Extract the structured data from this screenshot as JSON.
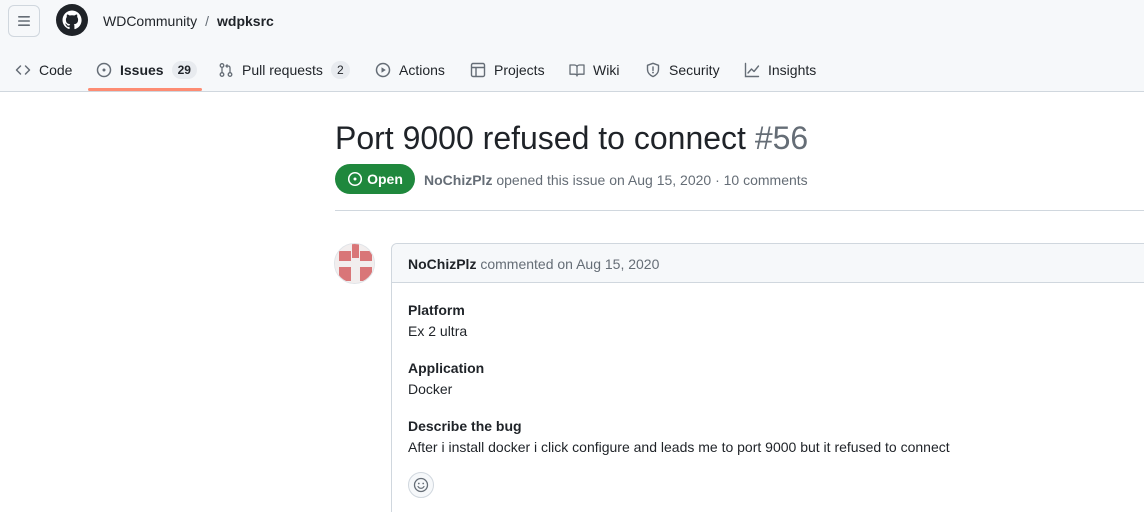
{
  "header": {
    "owner": "WDCommunity",
    "separator": "/",
    "repo": "wdpksrc"
  },
  "tabs": [
    {
      "label": "Code",
      "icon": "code-icon"
    },
    {
      "label": "Issues",
      "icon": "issue-opened-icon",
      "count": "29",
      "selected": true
    },
    {
      "label": "Pull requests",
      "icon": "git-pull-request-icon",
      "count": "2"
    },
    {
      "label": "Actions",
      "icon": "play-icon"
    },
    {
      "label": "Projects",
      "icon": "table-icon"
    },
    {
      "label": "Wiki",
      "icon": "book-icon"
    },
    {
      "label": "Security",
      "icon": "shield-icon"
    },
    {
      "label": "Insights",
      "icon": "graph-icon"
    }
  ],
  "issue": {
    "title": "Port 9000 refused to connect",
    "number": "#56",
    "state": "Open",
    "author": "NoChizPlz",
    "meta_text": "opened this issue on Aug 15, 2020 · 10 comments"
  },
  "comment": {
    "author": "NoChizPlz",
    "header_text": "commented on Aug 15, 2020",
    "fields": [
      {
        "label": "Platform",
        "value": "Ex 2 ultra"
      },
      {
        "label": "Application",
        "value": "Docker"
      },
      {
        "label": "Describe the bug",
        "value": "After i install docker i click configure and leads me to port 9000 but it refused to connect"
      }
    ]
  },
  "colors": {
    "accent_open": "#1f883d",
    "tab_underline": "#fd8c73",
    "border": "#d0d7de",
    "muted_text": "#656d76"
  }
}
